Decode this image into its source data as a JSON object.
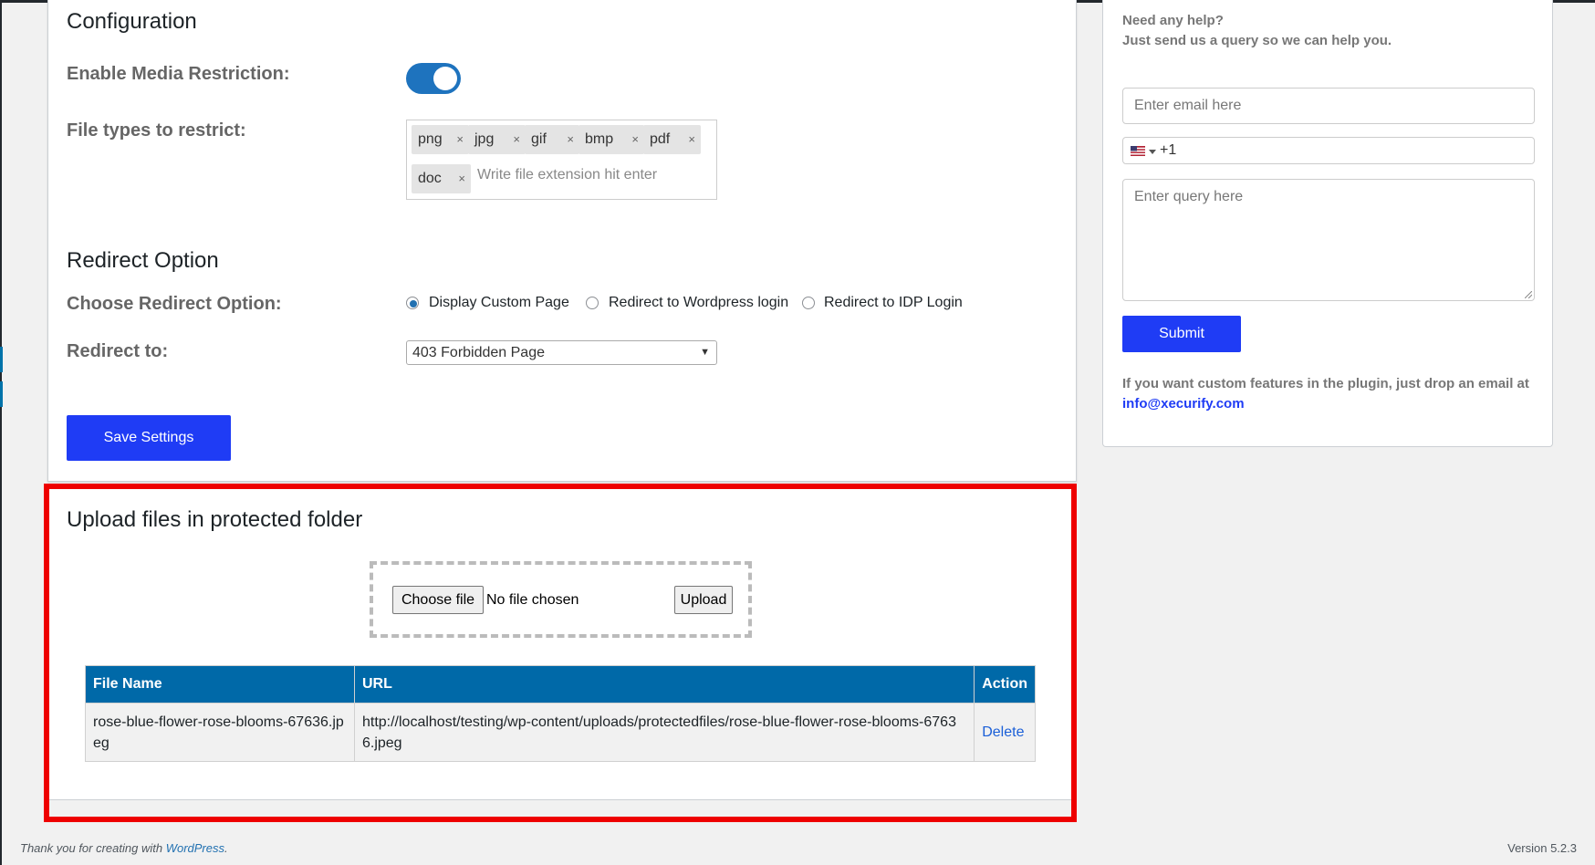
{
  "config": {
    "title": "Configuration",
    "enable_label": "Enable Media Restriction:",
    "enable_value": true,
    "file_types_label": "File types to restrict:",
    "file_types": [
      "png",
      "jpg",
      "gif",
      "bmp",
      "pdf",
      "doc"
    ],
    "file_types_placeholder": "Write file extension hit enter",
    "tag_remove_glyph": "×"
  },
  "redirect": {
    "title": "Redirect Option",
    "choose_label": "Choose Redirect Option:",
    "options": [
      "Display Custom Page",
      "Redirect to Wordpress login",
      "Redirect to IDP Login"
    ],
    "selected_option": "Display Custom Page",
    "redirect_to_label": "Redirect to:",
    "redirect_to_value": "403 Forbidden Page",
    "select_arrow": "▼"
  },
  "save_button": "Save Settings",
  "upload": {
    "title": "Upload files in protected folder",
    "choose_file_label": "Choose file",
    "no_file_text": "No file chosen",
    "upload_button": "Upload",
    "table": {
      "headers": [
        "File Name",
        "URL",
        "Action"
      ],
      "rows": [
        {
          "file_name": "rose-blue-flower-rose-blooms-67636.jpeg",
          "url": "http://localhost/testing/wp-content/uploads/protectedfiles/rose-blue-flower-rose-blooms-67636.jpeg",
          "action": "Delete"
        }
      ]
    }
  },
  "help": {
    "line1": "Need any help?",
    "line2": "Just send us a query so we can help you.",
    "email_placeholder": "Enter email here",
    "phone_prefix": "+1",
    "flag_icon": "us-flag-icon",
    "query_placeholder": "Enter query here",
    "submit_label": "Submit",
    "custom_text": "If you want custom features in the plugin, just drop an email at",
    "custom_email": "info@xecurify.com"
  },
  "footer": {
    "thanks_text": "Thank you for creating with",
    "wp_link": "WordPress",
    "thanks_end": ".",
    "version": "Version 5.2.3"
  },
  "colors": {
    "accent": "#1f3cf5",
    "table_header": "#0069a8",
    "toggle_on": "#1e73be",
    "highlight_border": "#ee0000"
  }
}
